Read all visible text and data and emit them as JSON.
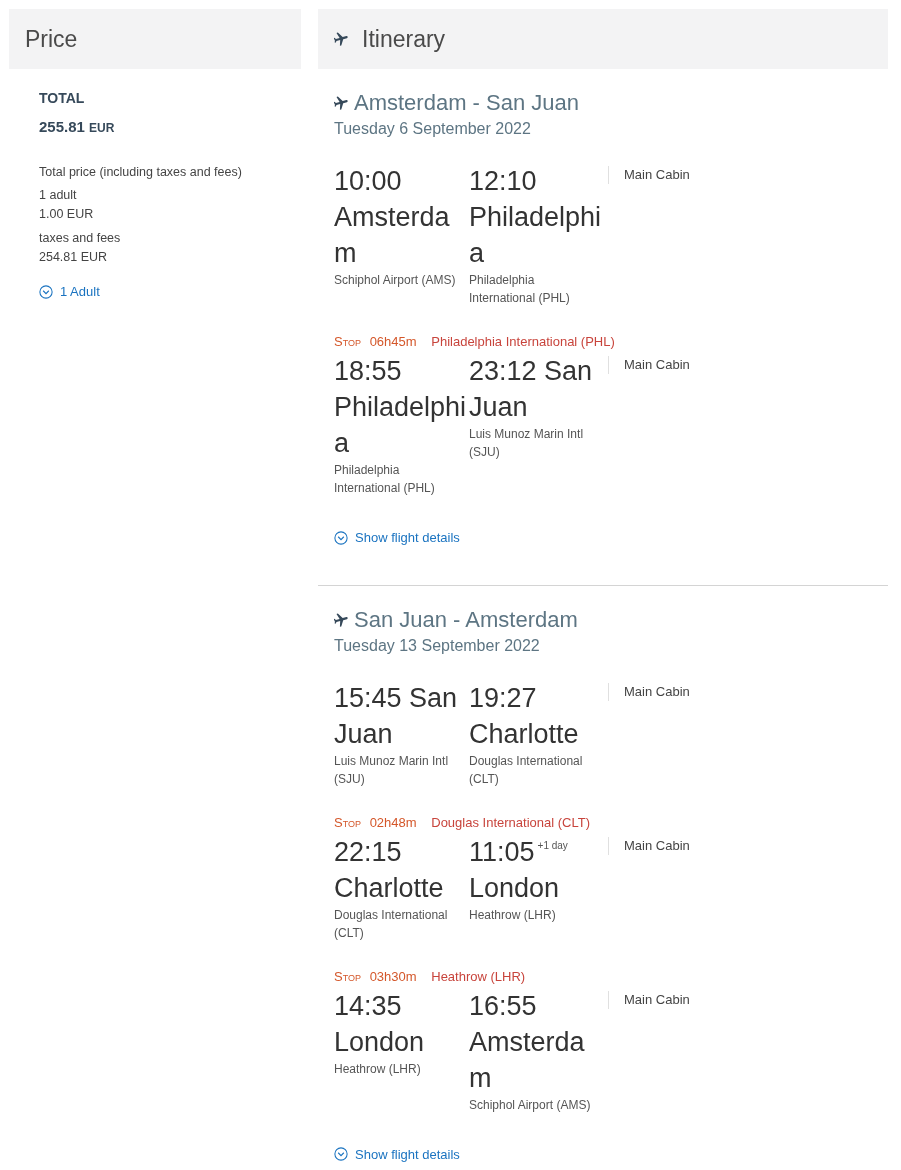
{
  "price": {
    "title": "Price",
    "total_label": "TOTAL",
    "total_amount": "255.81",
    "total_currency": "EUR",
    "description": "Total price (including taxes and fees)",
    "lines": [
      {
        "label": "1 adult",
        "amount": "1.00 EUR"
      },
      {
        "label": "taxes and fees",
        "amount": "254.81 EUR"
      }
    ],
    "passengers_link": {
      "label": "1 Adult",
      "expanded": false
    }
  },
  "itinerary": {
    "title": "Itinerary",
    "journeys": [
      {
        "route": "Amsterdam - San Juan",
        "date": "Tuesday 6 September 2022",
        "segments": [
          {
            "departure": {
              "time": "10:00",
              "city": "Amsterdam",
              "airport": "Schiphol Airport (AMS)"
            },
            "arrival": {
              "time": "12:10",
              "city": "Philadelphia",
              "airport": "Philadelphia International (PHL)"
            },
            "cabin": "Main Cabin"
          },
          {
            "stop": {
              "label": "Stop",
              "duration": "06h45m",
              "airport": "Philadelphia International (PHL)"
            },
            "departure": {
              "time": "18:55",
              "city": "Philadelphia",
              "airport": "Philadelphia International (PHL)"
            },
            "arrival": {
              "time": "23:12",
              "city": "San Juan",
              "airport": "Luis Munoz Marin Intl (SJU)"
            },
            "cabin": "Main Cabin"
          }
        ],
        "details_link": {
          "label": "Show flight details",
          "expanded": false
        }
      },
      {
        "route": "San Juan - Amsterdam",
        "date": "Tuesday 13 September 2022",
        "segments": [
          {
            "departure": {
              "time": "15:45",
              "city": "San Juan",
              "airport": "Luis Munoz Marin Intl (SJU)"
            },
            "arrival": {
              "time": "19:27",
              "city": "Charlotte",
              "airport": "Douglas International (CLT)"
            },
            "cabin": "Main Cabin"
          },
          {
            "stop": {
              "label": "Stop",
              "duration": "02h48m",
              "airport": "Douglas International (CLT)"
            },
            "departure": {
              "time": "22:15",
              "city": "Charlotte",
              "airport": "Douglas International (CLT)"
            },
            "arrival": {
              "time": "11:05",
              "day_offset": "+1 day",
              "city": "London",
              "airport": "Heathrow (LHR)"
            },
            "cabin": "Main Cabin"
          },
          {
            "stop": {
              "label": "Stop",
              "duration": "03h30m",
              "airport": "Heathrow (LHR)"
            },
            "departure": {
              "time": "14:35",
              "city": "London",
              "airport": "Heathrow (LHR)"
            },
            "arrival": {
              "time": "16:55",
              "city": "Amsterdam",
              "airport": "Schiphol Airport (AMS)"
            },
            "cabin": "Main Cabin"
          }
        ],
        "details_link": {
          "label": "Show flight details",
          "expanded": false
        }
      }
    ]
  }
}
